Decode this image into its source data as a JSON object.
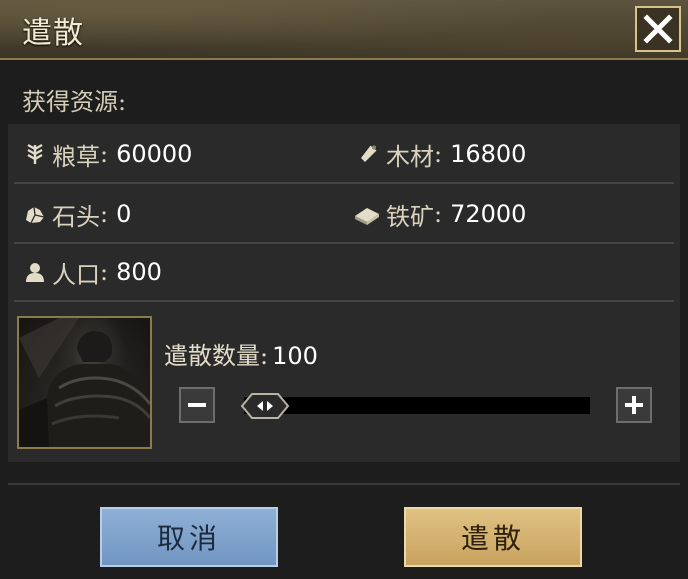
{
  "dialog": {
    "title": "遣散",
    "close_icon": "close-icon"
  },
  "resources": {
    "section_label": "获得资源:",
    "colon": ":",
    "items": [
      {
        "icon": "grain-icon",
        "label": "粮草",
        "value": "60000"
      },
      {
        "icon": "wood-icon",
        "label": "木材",
        "value": "16800"
      },
      {
        "icon": "stone-icon",
        "label": "石头",
        "value": "0"
      },
      {
        "icon": "iron-icon",
        "label": "铁矿",
        "value": "72000"
      },
      {
        "icon": "population-icon",
        "label": "人口",
        "value": "800"
      }
    ]
  },
  "dismiss": {
    "qty_label": "遣散数量:",
    "qty_value": "100",
    "slider_fraction": 0,
    "portrait": "armored-soldier-portrait"
  },
  "buttons": {
    "cancel": "取消",
    "confirm": "遣散"
  },
  "colors": {
    "title_bar": "#4a4331",
    "gold_border": "#8d7a4c",
    "cancel_button": "#7f a4cc",
    "confirm_button": "#d4b373"
  }
}
